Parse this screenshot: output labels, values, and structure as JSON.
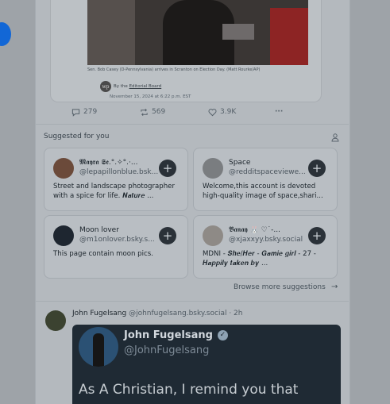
{
  "article": {
    "caption": "Sen. Bob Casey (D-Pennsylvania) arrives in Scranton on Election Day. (Matt Rourke/AP)",
    "logo_text": "wp",
    "by_prefix": "By the",
    "by_link": "Editorial Board",
    "date": "November 15, 2024 at 6:22 p.m. EST"
  },
  "post_actions": {
    "replies": "279",
    "reposts": "569",
    "likes": "3.9K",
    "more": "···"
  },
  "suggested": {
    "title": "Suggested for you",
    "browse_label": "Browse more suggestions",
    "browse_arrow": "→",
    "cards": [
      {
        "name": "𝕸𝖆𝖞𝖗𝖆 𝕾𝖊.°.✧°.·...",
        "handle": "@lepapillonblue.bsk...",
        "bio": "Street and landscape photographer with a spice for life. 𝑵𝒂𝒕𝒖𝒓𝒆 ...",
        "avatar_color": "#6b4a3a"
      },
      {
        "name": "Space",
        "handle": "@redditspaceviewe...",
        "bio": "Welcome,this account is devoted high-quality image of space,shari...",
        "avatar_color": "#7a7d80"
      },
      {
        "name": "Moon lover",
        "handle": "@m1onlover.bsky.s...",
        "bio": "This page contain moon pics.",
        "avatar_color": "#1e2630"
      },
      {
        "name": "𝕭𝖆𝖓𝖆𝖞 🐰 ♡˙-...",
        "handle": "@xjaxxyy.bsky.social",
        "bio": "MDNI - 𝑺𝒉𝒆/𝑯𝒆𝒓 - 𝑮𝒂𝒎𝒊𝒆 𝒈𝒊𝒓𝒍 - 27 - 𝑯𝒂𝒑𝒑𝒊𝒍𝒚 𝒕𝒂𝒌𝒆𝒏 𝒃𝒚 ...",
        "avatar_color": "#8e8a86"
      }
    ],
    "follow_glyph": "+"
  },
  "post": {
    "display_name": "John Fugelsang",
    "handle_time": "@johnfugelsang.bsky.social · 2h",
    "embed": {
      "name": "John Fugelsang",
      "check": "✓",
      "handle": "@JohnFugelsang",
      "text": "As A Christian, I remind you that"
    }
  },
  "icons": {
    "reply": "reply-icon",
    "repost": "repost-icon",
    "like": "heart-icon",
    "more": "more-icon",
    "people": "people-icon"
  }
}
